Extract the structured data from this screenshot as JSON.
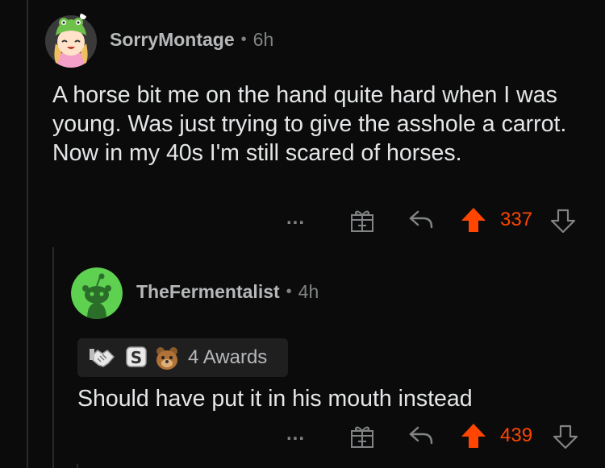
{
  "comments": [
    {
      "username": "SorryMontage",
      "separator": "•",
      "age": "6h",
      "text": "A horse bit me on the hand quite hard when I was young. Was just trying to give the asshole a carrot. Now in my 40s I'm still scared of horses.",
      "more_label": "...",
      "score": "337",
      "icons": {
        "avatar": "avatar-frog-hat-icon",
        "gift": "gift-icon",
        "reply": "reply-arrow-icon",
        "upvote": "upvote-icon",
        "downvote": "downvote-icon"
      }
    },
    {
      "username": "TheFermentalist",
      "separator": "•",
      "age": "4h",
      "awards_label": "4 Awards",
      "award_icons": [
        "handshake-award-icon",
        "silver-award-icon",
        "bear-award-icon"
      ],
      "text": "Should have put it in his mouth instead",
      "more_label": "...",
      "score": "439"
    }
  ],
  "colors": {
    "background": "#0b0b0b",
    "upvote_active": "#ff4500",
    "text": "#e4e6e8",
    "muted": "#818384",
    "avatar_green": "#5fd150"
  }
}
